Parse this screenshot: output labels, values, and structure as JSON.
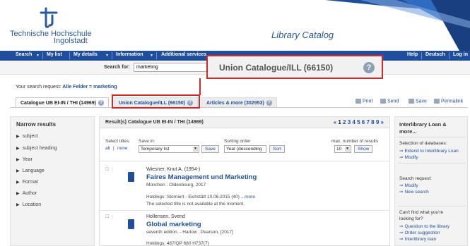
{
  "header": {
    "logo_line1": "Technische Hochschule",
    "logo_line2": "Ingolstadt",
    "title": "Library Catalog"
  },
  "nav": {
    "items": [
      "Search",
      "My list",
      "My details",
      "Information",
      "Additional services"
    ],
    "right_items": [
      "Help",
      "Deutsch",
      "Log in"
    ]
  },
  "search": {
    "label": "Search for:",
    "value": "marketing"
  },
  "request": {
    "label": "Your search request:",
    "value": "Alle Felder = marketing"
  },
  "tabs": [
    {
      "label": "Catalogue UB EI-IN / THI (14969)"
    },
    {
      "label": "Union Catalogue/ILL (66150)"
    },
    {
      "label": "Articles & more (302953)"
    }
  ],
  "actions": [
    "Print",
    "Send",
    "Save",
    "Permalink"
  ],
  "narrow": {
    "title": "Narrow results",
    "items": [
      "subject",
      "subject heading",
      "Year",
      "Language",
      "Format",
      "Author",
      "Location"
    ]
  },
  "results": {
    "title": "Result(s) Catalogue UB EI-IN / THI (14969)",
    "pager_prev": "«",
    "pages": [
      "1",
      "2",
      "3",
      "4",
      "5",
      "6",
      "7",
      "8",
      "9"
    ],
    "pager_next": "»",
    "select_titles_label": "Select titles:",
    "select_all": "all",
    "select_none": "none",
    "save_in_label": "Save in:",
    "save_in_value": "Temporary list",
    "save_button": "Save",
    "sorting_label": "Sorting order",
    "sorting_value": "Year (descending",
    "sort_button": "Sort",
    "max_label": "max. number of results",
    "max_value": "10",
    "show_button": "Show",
    "records": [
      {
        "author": "Wiesner, Knut A. (1954-)",
        "title": "Faires Management und Marketing",
        "publication": "München : Oldenbourg, 2017",
        "holdings": "Holdings: Storniert - Eichstätt 10.06.2015 (40)",
        "more": "...more",
        "note": "The selected title is not available at the moment."
      },
      {
        "author": "Hollensen, Svend",
        "title": "Global marketing",
        "publication": "seventh edition. - Harlow : Pearson, [2017]",
        "holdings": "Holdings: 487/QP 680 H737(7)"
      }
    ]
  },
  "right_panel": {
    "title_line1": "Interlibrary Loan &",
    "title_line2": "more...",
    "selection_label": "Selection of databases:",
    "selection_links": [
      "Extend to Interlibrary Loan",
      "Modify"
    ],
    "request_label": "Search request:",
    "request_links": [
      "Modify",
      "New search"
    ],
    "cant_find_line1": "Can't find what you're",
    "cant_find_line2": "looking for?",
    "cant_find_links": [
      "Question to the library",
      "Order suggestion",
      "Interlibrary loan"
    ]
  },
  "callout": {
    "text": "Union Catalogue/ILL (66150)",
    "help_glyph": "?"
  },
  "colors": {
    "nav_blue": "#1f4f9c",
    "highlight_red": "#d12a2a",
    "link_blue": "#1f4f9c"
  }
}
